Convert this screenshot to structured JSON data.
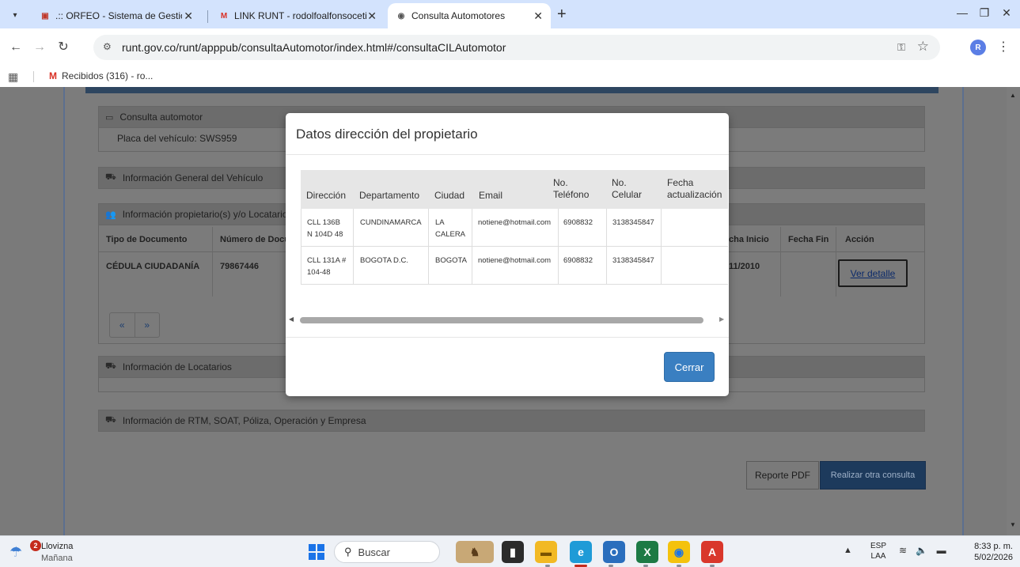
{
  "browser": {
    "tabs": [
      {
        "title": ".:: ORFEO - Sistema de Gestión",
        "favicon": "orfeo-icon"
      },
      {
        "title": "LINK RUNT - rodolfoalfonsoceti",
        "favicon": "gmail-icon"
      },
      {
        "title": "Consulta Automotores",
        "favicon": "globe-icon"
      }
    ],
    "url": "runt.gov.co/runt/apppub/consultaAutomotor/index.html#/consultaCILAutomotor",
    "profile_initial": "R",
    "bookmark": "Recibidos (316) - ro..."
  },
  "page": {
    "sections": {
      "consulta": "Consulta automotor",
      "info_general": "Información General del Vehículo",
      "propietarios": "Información propietario(s) y/o Locatario(s)",
      "locatarios": "Información de Locatarios",
      "rtm": "Información de RTM, SOAT, Póliza, Operación y Empresa"
    },
    "placa_label": "Placa del vehículo: SWS959",
    "owner_table": {
      "headers": {
        "tipo": "Tipo de Documento",
        "numero": "Número de Docu",
        "fecha_inicio": "cha Inicio",
        "fecha_fin": "Fecha Fin",
        "accion": "Acción"
      },
      "row": {
        "tipo": "CÉDULA CIUDADANÍA",
        "numero": "79867446",
        "fecha_inicio": "11/2010"
      }
    },
    "ver_detalle": "Ver detalle",
    "pager": {
      "prev": "«",
      "next": "»"
    },
    "buttons": {
      "reporte_pdf": "Reporte PDF",
      "otra_consulta": "Realizar otra consulta"
    }
  },
  "modal": {
    "title": "Datos dirección del propietario",
    "headers": {
      "direccion": "Dirección",
      "departamento": "Departamento",
      "ciudad": "Ciudad",
      "email": "Email",
      "telefono_1": "No.",
      "telefono_2": "Teléfono",
      "celular_1": "No.",
      "celular_2": "Celular",
      "fecha_1": "Fecha",
      "fecha_2": "actualización"
    },
    "rows": [
      {
        "direccion_1": "CLL 136B",
        "direccion_2": "N 104D 48",
        "departamento": "CUNDINAMARCA",
        "ciudad_1": "LA",
        "ciudad_2": "CALERA",
        "email": "notiene@hotmail.com",
        "telefono": "6908832",
        "celular": "3138345847",
        "fecha": ""
      },
      {
        "direccion_1": "CLL 131A #",
        "direccion_2": "104-48",
        "departamento": "BOGOTA D.C.",
        "ciudad_1": "BOGOTA",
        "ciudad_2": "",
        "email": "notiene@hotmail.com",
        "telefono": "6908832",
        "celular": "3138345847",
        "fecha": ""
      }
    ],
    "close_button": "Cerrar"
  },
  "taskbar": {
    "weather_badge": "2",
    "weather_title": "Llovizna",
    "weather_sub": "Mañana",
    "search_label": "Buscar",
    "lang_1": "ESP",
    "lang_2": "LAA",
    "time": "8:33 p. m.",
    "date": "5/02/2026"
  },
  "colors": {
    "accent": "#3a7fc1",
    "page_header": "#2e4660",
    "tab_strip": "#d3e3fd"
  }
}
